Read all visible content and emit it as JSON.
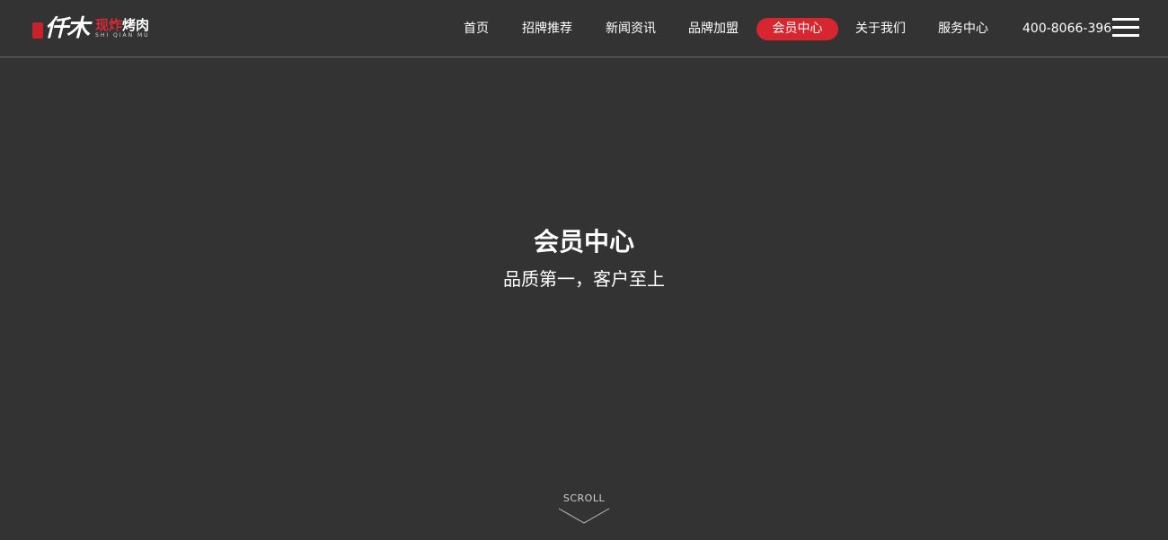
{
  "brand": {
    "logo_main": "仟木",
    "logo_tag_red": "现炸",
    "logo_tag_white": "烤肉",
    "logo_en": "SHI QIAN MU"
  },
  "nav": {
    "items": [
      {
        "label": "首页"
      },
      {
        "label": "招牌推荐"
      },
      {
        "label": "新闻资讯"
      },
      {
        "label": "品牌加盟"
      },
      {
        "label": "会员中心",
        "active": true
      },
      {
        "label": "关于我们"
      },
      {
        "label": "服务中心"
      }
    ],
    "phone": "400-8066-396",
    "menu_icon": "hamburger-menu-icon"
  },
  "hero": {
    "title": "会员中心",
    "subtitle": "品质第一，客户至上"
  },
  "scroll": {
    "label": "SCROLL",
    "icon": "chevron-down-icon"
  },
  "colors": {
    "background": "#333333",
    "accent": "#d7262f",
    "text": "#ffffff"
  }
}
